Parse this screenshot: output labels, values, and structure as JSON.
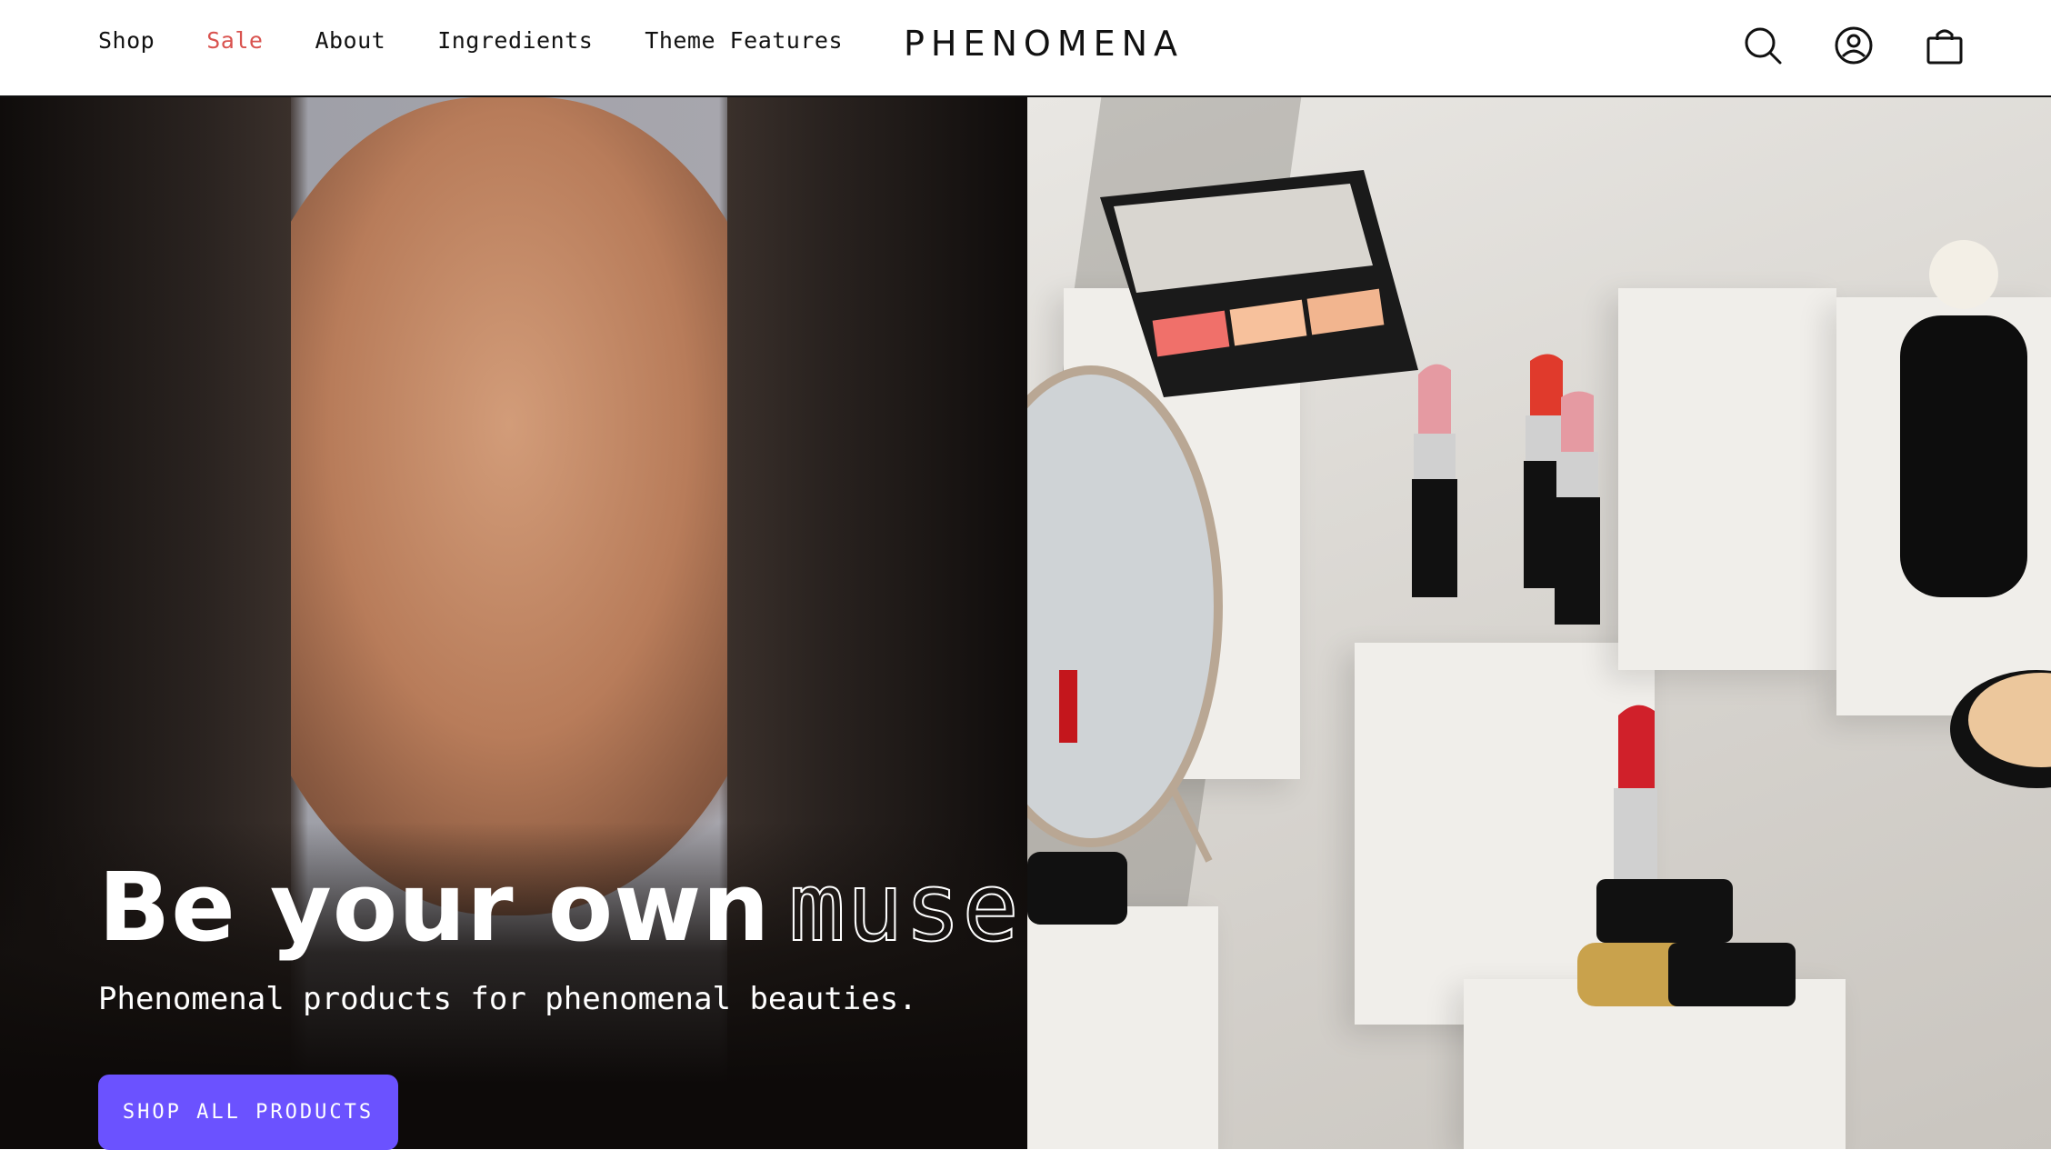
{
  "nav": {
    "items": [
      {
        "label": "Shop"
      },
      {
        "label": "Sale"
      },
      {
        "label": "About"
      },
      {
        "label": "Ingredients"
      },
      {
        "label": "Theme Features"
      }
    ]
  },
  "brand": {
    "logo": "PHENOMENA"
  },
  "header_icons": [
    "search-icon",
    "account-icon",
    "cart-icon"
  ],
  "hero": {
    "headline_bold": "Be your own",
    "headline_outline": "muse",
    "subtitle": "Phenomenal products for phenomenal beauties.",
    "cta_label": "SHOP ALL PRODUCTS"
  },
  "colors": {
    "sale": "#d9534f",
    "cta_background": "#6b52ff"
  }
}
